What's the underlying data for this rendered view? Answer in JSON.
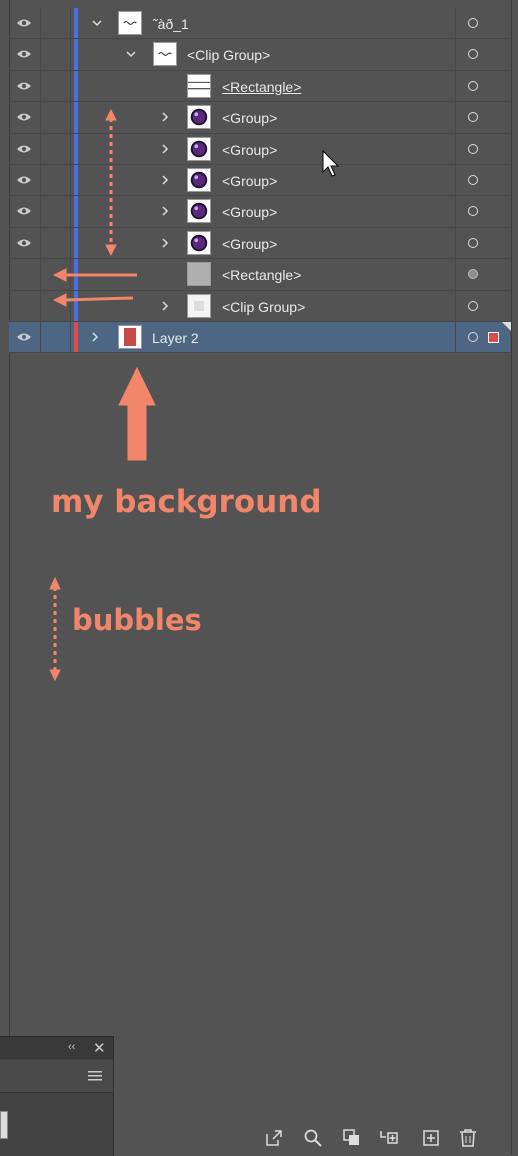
{
  "layers": [
    {
      "name": "˜àð_1",
      "visible": true,
      "expanded": true,
      "indent": 1,
      "thumb": "sketch"
    },
    {
      "name": "<Clip Group>",
      "visible": true,
      "expanded": true,
      "indent": 2,
      "thumb": "sketch"
    },
    {
      "name": "<Rectangle>",
      "visible": true,
      "indent": 3,
      "thumb": "lines",
      "underline": true
    },
    {
      "name": "<Group>",
      "visible": true,
      "expanded": false,
      "indent": 3,
      "thumb": "bubble"
    },
    {
      "name": "<Group>",
      "visible": true,
      "expanded": false,
      "indent": 3,
      "thumb": "bubble"
    },
    {
      "name": "<Group>",
      "visible": true,
      "expanded": false,
      "indent": 3,
      "thumb": "bubble"
    },
    {
      "name": "<Group>",
      "visible": true,
      "expanded": false,
      "indent": 3,
      "thumb": "bubble"
    },
    {
      "name": "<Group>",
      "visible": true,
      "expanded": false,
      "indent": 3,
      "thumb": "bubble"
    },
    {
      "name": "<Rectangle>",
      "visible": false,
      "indent": 3,
      "thumb": "gray",
      "target_filled": true
    },
    {
      "name": "<Clip Group>",
      "visible": false,
      "expanded": false,
      "indent": 3,
      "thumb": "white"
    },
    {
      "name": "Layer 2",
      "visible": true,
      "expanded": false,
      "indent": 0,
      "thumb": "redlayer",
      "selected": true
    }
  ],
  "annotations": {
    "background_label": "my background",
    "bubbles_label": "bubbles"
  },
  "colors": {
    "layer1": "#4a6ee8",
    "layer2": "#e24a4a",
    "annotation": "#f2866b",
    "selected_row": "#4d6684"
  },
  "bottom_icons": [
    "export-icon",
    "search-icon",
    "clipping-mask-icon",
    "move-to-layer-icon",
    "new-layer-icon",
    "delete-icon"
  ]
}
